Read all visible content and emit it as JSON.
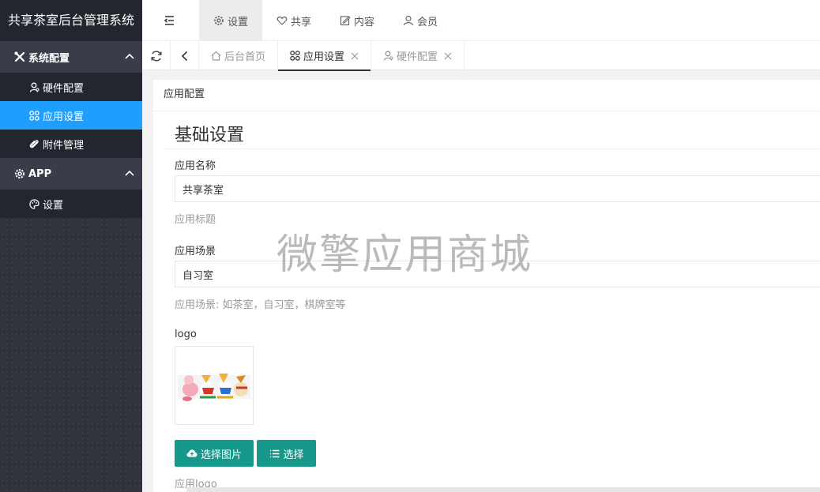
{
  "app": {
    "title": "共享茶室后台管理系统"
  },
  "sidebar": {
    "groups": [
      {
        "label": "系统配置",
        "icon": "tools-icon",
        "items": [
          {
            "label": "硬件配置",
            "icon": "user-icon"
          },
          {
            "label": "应用设置",
            "icon": "apps-icon",
            "active": true
          },
          {
            "label": "附件管理",
            "icon": "paperclip-icon"
          }
        ]
      },
      {
        "label": "APP",
        "icon": "gear-icon",
        "items": [
          {
            "label": "设置",
            "icon": "palette-icon"
          }
        ]
      }
    ]
  },
  "topnav": [
    {
      "label": "设置",
      "icon": "gear-icon",
      "active": true
    },
    {
      "label": "共享",
      "icon": "heart-icon"
    },
    {
      "label": "内容",
      "icon": "edit-icon"
    },
    {
      "label": "会员",
      "icon": "user-icon"
    }
  ],
  "tabs": [
    {
      "label": "后台首页",
      "icon": "home-icon",
      "closable": false
    },
    {
      "label": "应用设置",
      "icon": "apps-icon",
      "closable": true,
      "active": true
    },
    {
      "label": "硬件配置",
      "icon": "user-icon",
      "closable": true
    }
  ],
  "card": {
    "header": "应用配置",
    "section_title": "基础设置",
    "fields": {
      "name": {
        "label": "应用名称",
        "value": "共享茶室",
        "help": "应用标题"
      },
      "scene": {
        "label": "应用场景",
        "value": "自习室",
        "help": "应用场景: 如茶室，自习室，棋牌室等"
      },
      "logo": {
        "label": "logo",
        "help": "应用logo"
      }
    },
    "buttons": {
      "upload": "选择图片",
      "choose": "选择"
    }
  },
  "watermark": "微擎应用商城",
  "colors": {
    "sidebar_bg": "#2f323a",
    "active_blue": "#1e9fff",
    "button_teal": "#16988a"
  }
}
